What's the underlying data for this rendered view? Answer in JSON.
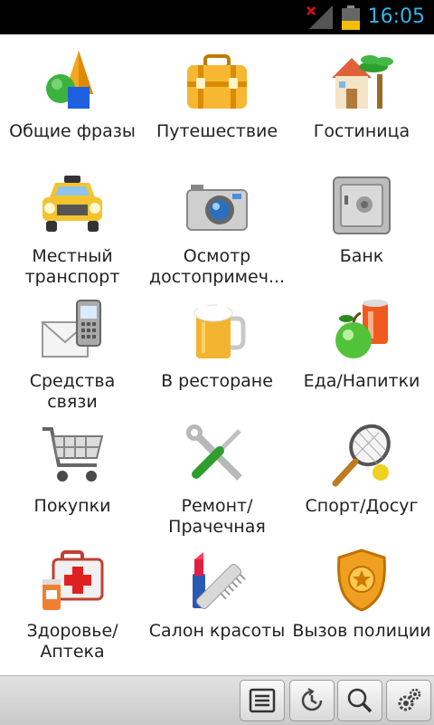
{
  "status_bar": {
    "time": "16:05",
    "signal_icon": "signal-off-icon",
    "battery_icon": "battery-low-icon"
  },
  "categories": [
    {
      "label": "Общие фразы",
      "icon": "shapes-icon"
    },
    {
      "label": "Путешествие",
      "icon": "suitcase-icon"
    },
    {
      "label": "Гостиница",
      "icon": "hotel-palm-icon"
    },
    {
      "label": "Местный\nтранспорт",
      "icon": "taxi-icon"
    },
    {
      "label": "Осмотр\nдостопримеч...",
      "icon": "camera-icon"
    },
    {
      "label": "Банк",
      "icon": "safe-icon"
    },
    {
      "label": "Средства\nсвязи",
      "icon": "envelope-phone-icon"
    },
    {
      "label": "В ресторане",
      "icon": "beer-mug-icon"
    },
    {
      "label": "Еда/Напитки",
      "icon": "apple-can-icon"
    },
    {
      "label": "Покупки",
      "icon": "shopping-cart-icon"
    },
    {
      "label": "Ремонт/\nПрачечная",
      "icon": "tools-icon"
    },
    {
      "label": "Спорт/Досуг",
      "icon": "tennis-racket-icon"
    },
    {
      "label": "Здоровье/\nАптека",
      "icon": "first-aid-kit-icon"
    },
    {
      "label": "Салон красоты",
      "icon": "lipstick-comb-icon"
    },
    {
      "label": "Вызов полиции",
      "icon": "police-badge-icon"
    }
  ],
  "bottom_bar": {
    "buttons": [
      {
        "icon": "list-icon"
      },
      {
        "icon": "history-icon"
      },
      {
        "icon": "search-icon"
      },
      {
        "icon": "settings-icon"
      }
    ]
  }
}
